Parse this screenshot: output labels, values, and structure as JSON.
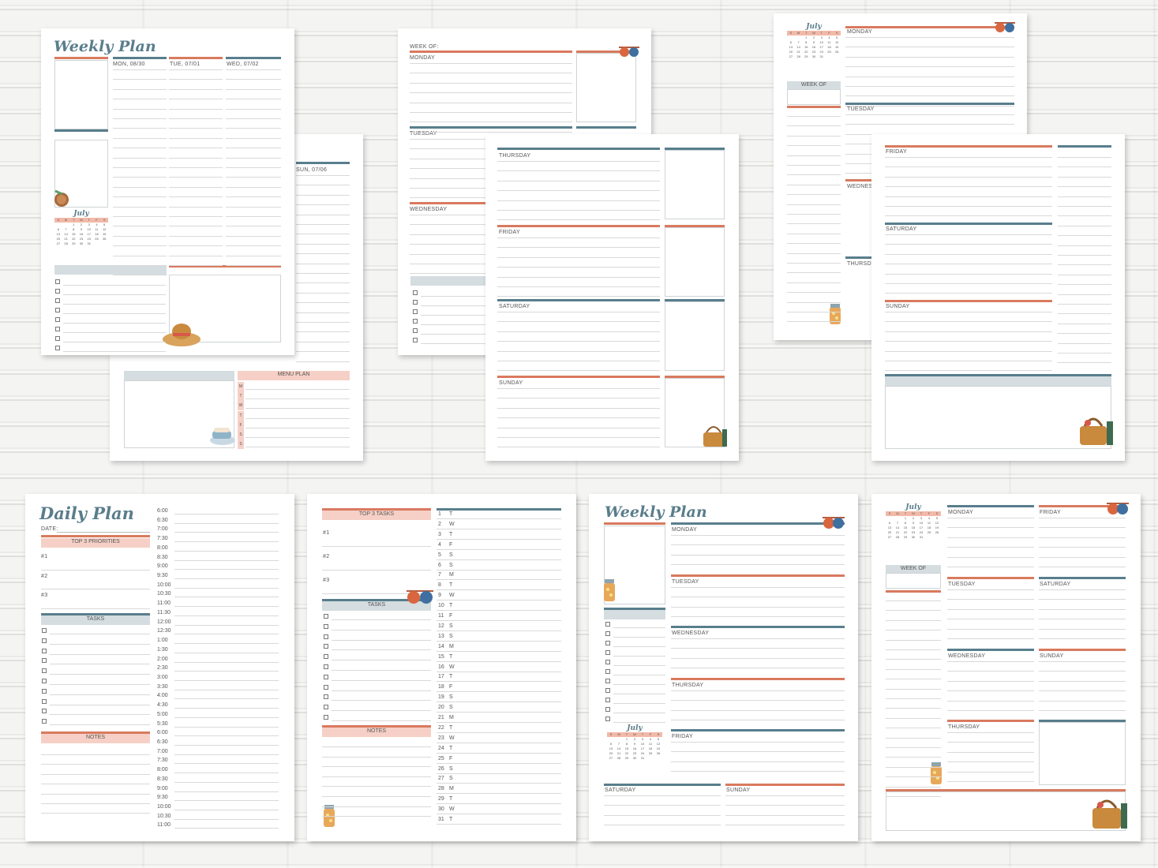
{
  "colors": {
    "teal": "#587e8c",
    "coral": "#d97a5f",
    "pink": "#f6d0c6",
    "gray": "#d5dde0"
  },
  "calendar": {
    "month": "July",
    "weekdays": [
      "S",
      "M",
      "T",
      "W",
      "T",
      "F",
      "S"
    ],
    "weeks": [
      [
        "",
        "",
        "1",
        "2",
        "3",
        "4",
        "5"
      ],
      [
        "6",
        "7",
        "8",
        "9",
        "10",
        "11",
        "12"
      ],
      [
        "13",
        "14",
        "15",
        "16",
        "17",
        "18",
        "19"
      ],
      [
        "20",
        "21",
        "22",
        "23",
        "24",
        "25",
        "26"
      ],
      [
        "27",
        "28",
        "29",
        "30",
        "31",
        "",
        ""
      ]
    ]
  },
  "weekly1": {
    "title": "Weekly Plan",
    "days": [
      "MON, 08/30",
      "TUE, 07/01",
      "WED, 07/02"
    ]
  },
  "weekly1b": {
    "day": "SUN, 07/06",
    "menu": "MENU PLAN",
    "menu_days": [
      "M",
      "T",
      "W",
      "T",
      "F",
      "S",
      "S"
    ]
  },
  "page2": {
    "week_of": "WEEK OF:",
    "days": [
      "MONDAY",
      "TUESDAY",
      "WEDNESDAY"
    ]
  },
  "page3": {
    "days": [
      "THURSDAY",
      "FRIDAY",
      "SATURDAY",
      "SUNDAY"
    ]
  },
  "page4": {
    "week_of": "WEEK OF",
    "days": [
      "MONDAY",
      "TUESDAY",
      "WEDNESD",
      "THURSDA"
    ]
  },
  "page5": {
    "days": [
      "FRIDAY",
      "SATURDAY",
      "SUNDAY"
    ]
  },
  "daily": {
    "title": "Daily Plan",
    "date": "DATE:",
    "priorities": "TOP 3 PRIORITIES",
    "p": [
      "#1",
      "#2",
      "#3"
    ],
    "tasks": "TASKS",
    "notes": "NOTES",
    "times": [
      "6:00",
      "6:30",
      "7:00",
      "7:30",
      "8:00",
      "8:30",
      "9:00",
      "9:30",
      "10:00",
      "10:30",
      "11:00",
      "11:30",
      "12:00",
      "12:30",
      "1:00",
      "1:30",
      "2:00",
      "2:30",
      "3:00",
      "3:30",
      "4:00",
      "4:30",
      "5:00",
      "5:30",
      "6:00",
      "6:30",
      "7:00",
      "7:30",
      "8:00",
      "8:30",
      "9:00",
      "9:30",
      "10:00",
      "10:30",
      "11:00"
    ]
  },
  "monthly": {
    "top3": "TOP 3 TASKS",
    "p": [
      "#1",
      "#2",
      "#3"
    ],
    "tasks": "TASKS",
    "notes": "NOTES",
    "nums": [
      "1",
      "2",
      "3",
      "4",
      "5",
      "6",
      "7",
      "8",
      "9",
      "10",
      "11",
      "12",
      "13",
      "14",
      "15",
      "16",
      "17",
      "18",
      "19",
      "20",
      "21",
      "22",
      "23",
      "24",
      "25",
      "26",
      "27",
      "28",
      "29",
      "30",
      "31"
    ],
    "dows": [
      "T",
      "W",
      "T",
      "F",
      "S",
      "S",
      "M",
      "T",
      "W",
      "T",
      "F",
      "S",
      "S",
      "M",
      "T",
      "W",
      "T",
      "F",
      "S",
      "S",
      "M",
      "T",
      "W",
      "T",
      "F",
      "S",
      "S",
      "M",
      "T",
      "W",
      "T"
    ]
  },
  "weekly2": {
    "title": "Weekly Plan",
    "days": [
      "MONDAY",
      "TUESDAY",
      "WEDNESDAY",
      "THURSDAY",
      "FRIDAY"
    ],
    "weekend": [
      "SATURDAY",
      "SUNDAY"
    ]
  },
  "weekly3": {
    "week_of": "WEEK OF",
    "left": [
      "MONDAY",
      "TUESDAY",
      "WEDNESDAY",
      "THURSDAY"
    ],
    "right": [
      "FRIDAY",
      "SATURDAY",
      "SUNDAY"
    ]
  }
}
